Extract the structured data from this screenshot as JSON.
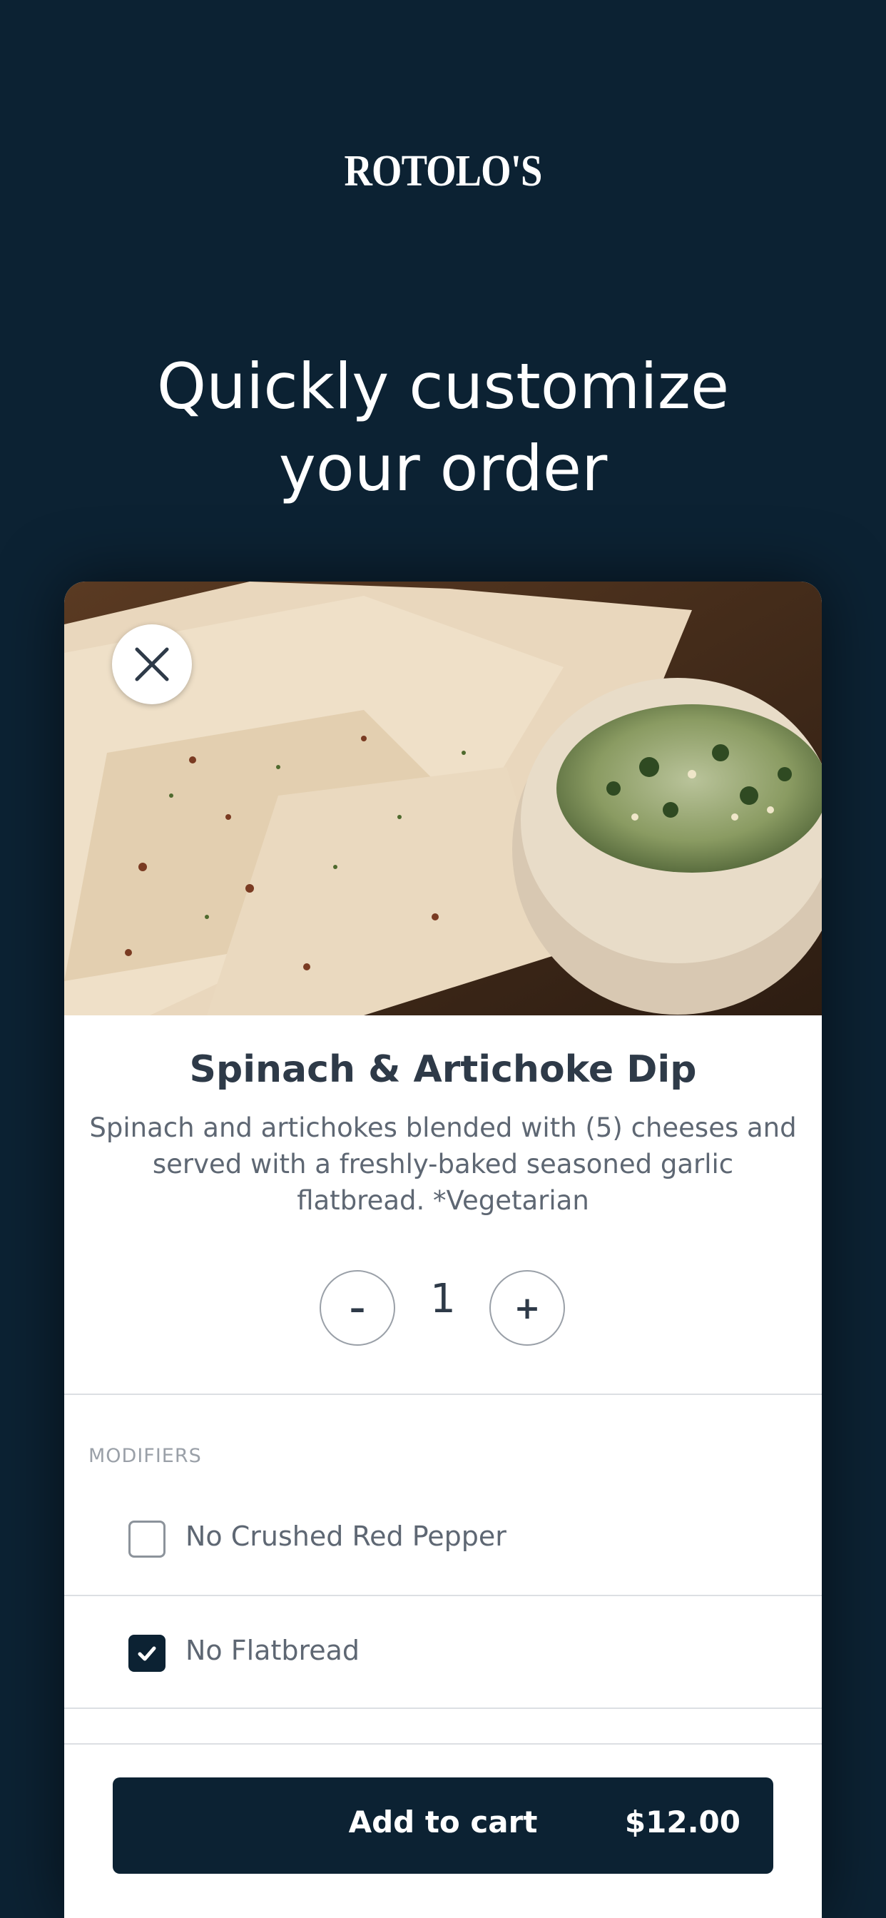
{
  "brand": {
    "logo_text": "ROTOLO'S"
  },
  "headline": {
    "line1": "Quickly customize",
    "line2": "your order"
  },
  "item": {
    "name": "Spinach & Artichoke Dip",
    "description": "Spinach and artichokes blended with (5) cheeses and served with a freshly-baked seasoned garlic flatbread. *Vegetarian",
    "image_icon": "food-photo",
    "close_icon": "close-icon"
  },
  "quantity": {
    "minus_label": "–",
    "value": "1",
    "plus_label": "+"
  },
  "modifiers": {
    "header": "MODIFIERS",
    "items": [
      {
        "label": "No Crushed Red Pepper",
        "checked": false
      },
      {
        "label": "No Flatbread",
        "checked": true
      }
    ]
  },
  "cart": {
    "button_label": "Add to cart",
    "price": "$12.00"
  },
  "colors": {
    "background": "#0c2233",
    "accent": "#0c2233",
    "card": "#ffffff"
  }
}
